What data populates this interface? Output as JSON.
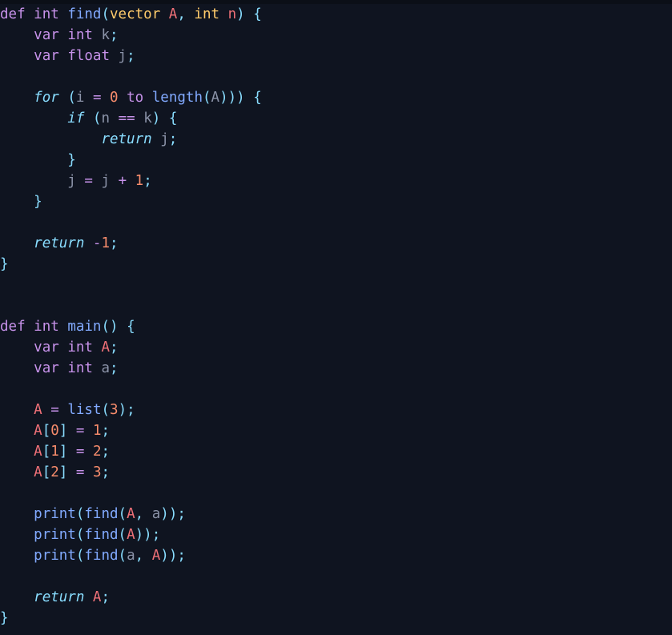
{
  "editor": {
    "name": "code-editor",
    "language": "pseudocode",
    "background_color": "#0f1420",
    "top_edge_color": "#0b0f17",
    "font_size_px": 17.5,
    "line_height_px": 26,
    "indent_spaces": 4,
    "total_lines": 33
  },
  "theme": {
    "name": "dark-material",
    "foreground": "#c6cde0",
    "keyword_declaration": "#c792ea",
    "keyword_control": "#89ddff",
    "function": "#82aaff",
    "type": "#ffcb6b",
    "error_identifier": "#f07178",
    "identifier": "#8b93a8",
    "number": "#f78c6c",
    "operator": "#c792ea",
    "punctuation": "#89ddff"
  },
  "code": {
    "lines": [
      {
        "n": 1,
        "text": "def int find(vector A, int n) {",
        "tokens": [
          {
            "t": "def",
            "c": "tok-def"
          },
          {
            "t": " ",
            "c": "plain"
          },
          {
            "t": "int",
            "c": "tok-def"
          },
          {
            "t": " ",
            "c": "plain"
          },
          {
            "t": "find",
            "c": "tok-fn"
          },
          {
            "t": "(",
            "c": "tok-punct"
          },
          {
            "t": "vector",
            "c": "tok-type"
          },
          {
            "t": " ",
            "c": "plain"
          },
          {
            "t": "A",
            "c": "tok-err"
          },
          {
            "t": ",",
            "c": "tok-punct"
          },
          {
            "t": " ",
            "c": "plain"
          },
          {
            "t": "int",
            "c": "tok-type"
          },
          {
            "t": " ",
            "c": "plain"
          },
          {
            "t": "n",
            "c": "tok-err"
          },
          {
            "t": ")",
            "c": "tok-punct"
          },
          {
            "t": " ",
            "c": "plain"
          },
          {
            "t": "{",
            "c": "tok-punct"
          }
        ]
      },
      {
        "n": 2,
        "text": "    var int k;",
        "tokens": [
          {
            "t": "    ",
            "c": "plain"
          },
          {
            "t": "var",
            "c": "tok-def"
          },
          {
            "t": " ",
            "c": "plain"
          },
          {
            "t": "int",
            "c": "tok-def"
          },
          {
            "t": " ",
            "c": "plain"
          },
          {
            "t": "k",
            "c": "tok-var"
          },
          {
            "t": ";",
            "c": "tok-punct"
          }
        ]
      },
      {
        "n": 3,
        "text": "    var float j;",
        "tokens": [
          {
            "t": "    ",
            "c": "plain"
          },
          {
            "t": "var",
            "c": "tok-def"
          },
          {
            "t": " ",
            "c": "plain"
          },
          {
            "t": "float",
            "c": "tok-def"
          },
          {
            "t": " ",
            "c": "plain"
          },
          {
            "t": "j",
            "c": "tok-var"
          },
          {
            "t": ";",
            "c": "tok-punct"
          }
        ]
      },
      {
        "n": 4,
        "text": "",
        "tokens": []
      },
      {
        "n": 5,
        "text": "    for (i = 0 to length(A))) {",
        "tokens": [
          {
            "t": "    ",
            "c": "plain"
          },
          {
            "t": "for",
            "c": "tok-kw"
          },
          {
            "t": " ",
            "c": "plain"
          },
          {
            "t": "(",
            "c": "tok-punct"
          },
          {
            "t": "i",
            "c": "tok-var"
          },
          {
            "t": " ",
            "c": "plain"
          },
          {
            "t": "=",
            "c": "tok-op"
          },
          {
            "t": " ",
            "c": "plain"
          },
          {
            "t": "0",
            "c": "tok-num"
          },
          {
            "t": " ",
            "c": "plain"
          },
          {
            "t": "to",
            "c": "tok-op-kw"
          },
          {
            "t": " ",
            "c": "plain"
          },
          {
            "t": "length",
            "c": "tok-fn"
          },
          {
            "t": "(",
            "c": "tok-punct"
          },
          {
            "t": "A",
            "c": "tok-var"
          },
          {
            "t": ")))",
            "c": "tok-punct"
          },
          {
            "t": " ",
            "c": "plain"
          },
          {
            "t": "{",
            "c": "tok-punct"
          }
        ]
      },
      {
        "n": 6,
        "text": "        if (n == k) {",
        "tokens": [
          {
            "t": "        ",
            "c": "plain"
          },
          {
            "t": "if",
            "c": "tok-kw"
          },
          {
            "t": " ",
            "c": "plain"
          },
          {
            "t": "(",
            "c": "tok-punct"
          },
          {
            "t": "n",
            "c": "tok-var"
          },
          {
            "t": " ",
            "c": "plain"
          },
          {
            "t": "==",
            "c": "tok-op"
          },
          {
            "t": " ",
            "c": "plain"
          },
          {
            "t": "k",
            "c": "tok-var"
          },
          {
            "t": ")",
            "c": "tok-punct"
          },
          {
            "t": " ",
            "c": "plain"
          },
          {
            "t": "{",
            "c": "tok-punct"
          }
        ]
      },
      {
        "n": 7,
        "text": "            return j;",
        "tokens": [
          {
            "t": "            ",
            "c": "plain"
          },
          {
            "t": "return",
            "c": "tok-kw"
          },
          {
            "t": " ",
            "c": "plain"
          },
          {
            "t": "j",
            "c": "tok-var"
          },
          {
            "t": ";",
            "c": "tok-punct"
          }
        ]
      },
      {
        "n": 8,
        "text": "        }",
        "tokens": [
          {
            "t": "        ",
            "c": "plain"
          },
          {
            "t": "}",
            "c": "tok-punct"
          }
        ]
      },
      {
        "n": 9,
        "text": "        j = j + 1;",
        "tokens": [
          {
            "t": "        ",
            "c": "plain"
          },
          {
            "t": "j",
            "c": "tok-var"
          },
          {
            "t": " ",
            "c": "plain"
          },
          {
            "t": "=",
            "c": "tok-op"
          },
          {
            "t": " ",
            "c": "plain"
          },
          {
            "t": "j",
            "c": "tok-var"
          },
          {
            "t": " ",
            "c": "plain"
          },
          {
            "t": "+",
            "c": "tok-op"
          },
          {
            "t": " ",
            "c": "plain"
          },
          {
            "t": "1",
            "c": "tok-num"
          },
          {
            "t": ";",
            "c": "tok-punct"
          }
        ]
      },
      {
        "n": 10,
        "text": "    }",
        "tokens": [
          {
            "t": "    ",
            "c": "plain"
          },
          {
            "t": "}",
            "c": "tok-punct"
          }
        ]
      },
      {
        "n": 11,
        "text": "",
        "tokens": []
      },
      {
        "n": 12,
        "text": "    return -1;",
        "tokens": [
          {
            "t": "    ",
            "c": "plain"
          },
          {
            "t": "return",
            "c": "tok-kw"
          },
          {
            "t": " ",
            "c": "plain"
          },
          {
            "t": "-",
            "c": "tok-op"
          },
          {
            "t": "1",
            "c": "tok-num"
          },
          {
            "t": ";",
            "c": "tok-punct"
          }
        ]
      },
      {
        "n": 13,
        "text": "}",
        "tokens": [
          {
            "t": "}",
            "c": "tok-punct"
          }
        ]
      },
      {
        "n": 14,
        "text": "",
        "tokens": []
      },
      {
        "n": 15,
        "text": "",
        "tokens": []
      },
      {
        "n": 16,
        "text": "def int main() {",
        "tokens": [
          {
            "t": "def",
            "c": "tok-def"
          },
          {
            "t": " ",
            "c": "plain"
          },
          {
            "t": "int",
            "c": "tok-def"
          },
          {
            "t": " ",
            "c": "plain"
          },
          {
            "t": "main",
            "c": "tok-fn"
          },
          {
            "t": "()",
            "c": "tok-punct"
          },
          {
            "t": " ",
            "c": "plain"
          },
          {
            "t": "{",
            "c": "tok-punct"
          }
        ]
      },
      {
        "n": 17,
        "text": "    var int A;",
        "tokens": [
          {
            "t": "    ",
            "c": "plain"
          },
          {
            "t": "var",
            "c": "tok-def"
          },
          {
            "t": " ",
            "c": "plain"
          },
          {
            "t": "int",
            "c": "tok-def"
          },
          {
            "t": " ",
            "c": "plain"
          },
          {
            "t": "A",
            "c": "tok-err"
          },
          {
            "t": ";",
            "c": "tok-punct"
          }
        ]
      },
      {
        "n": 18,
        "text": "    var int a;",
        "tokens": [
          {
            "t": "    ",
            "c": "plain"
          },
          {
            "t": "var",
            "c": "tok-def"
          },
          {
            "t": " ",
            "c": "plain"
          },
          {
            "t": "int",
            "c": "tok-def"
          },
          {
            "t": " ",
            "c": "plain"
          },
          {
            "t": "a",
            "c": "tok-var"
          },
          {
            "t": ";",
            "c": "tok-punct"
          }
        ]
      },
      {
        "n": 19,
        "text": "",
        "tokens": []
      },
      {
        "n": 20,
        "text": "    A = list(3);",
        "tokens": [
          {
            "t": "    ",
            "c": "plain"
          },
          {
            "t": "A",
            "c": "tok-err"
          },
          {
            "t": " ",
            "c": "plain"
          },
          {
            "t": "=",
            "c": "tok-op"
          },
          {
            "t": " ",
            "c": "plain"
          },
          {
            "t": "list",
            "c": "tok-fn"
          },
          {
            "t": "(",
            "c": "tok-punct"
          },
          {
            "t": "3",
            "c": "tok-num"
          },
          {
            "t": ");",
            "c": "tok-punct"
          }
        ]
      },
      {
        "n": 21,
        "text": "    A[0] = 1;",
        "tokens": [
          {
            "t": "    ",
            "c": "plain"
          },
          {
            "t": "A",
            "c": "tok-err"
          },
          {
            "t": "[",
            "c": "tok-punct"
          },
          {
            "t": "0",
            "c": "tok-num"
          },
          {
            "t": "]",
            "c": "tok-punct"
          },
          {
            "t": " ",
            "c": "plain"
          },
          {
            "t": "=",
            "c": "tok-op"
          },
          {
            "t": " ",
            "c": "plain"
          },
          {
            "t": "1",
            "c": "tok-num"
          },
          {
            "t": ";",
            "c": "tok-punct"
          }
        ]
      },
      {
        "n": 22,
        "text": "    A[1] = 2;",
        "tokens": [
          {
            "t": "    ",
            "c": "plain"
          },
          {
            "t": "A",
            "c": "tok-err"
          },
          {
            "t": "[",
            "c": "tok-punct"
          },
          {
            "t": "1",
            "c": "tok-num"
          },
          {
            "t": "]",
            "c": "tok-punct"
          },
          {
            "t": " ",
            "c": "plain"
          },
          {
            "t": "=",
            "c": "tok-op"
          },
          {
            "t": " ",
            "c": "plain"
          },
          {
            "t": "2",
            "c": "tok-num"
          },
          {
            "t": ";",
            "c": "tok-punct"
          }
        ]
      },
      {
        "n": 23,
        "text": "    A[2] = 3;",
        "tokens": [
          {
            "t": "    ",
            "c": "plain"
          },
          {
            "t": "A",
            "c": "tok-err"
          },
          {
            "t": "[",
            "c": "tok-punct"
          },
          {
            "t": "2",
            "c": "tok-num"
          },
          {
            "t": "]",
            "c": "tok-punct"
          },
          {
            "t": " ",
            "c": "plain"
          },
          {
            "t": "=",
            "c": "tok-op"
          },
          {
            "t": " ",
            "c": "plain"
          },
          {
            "t": "3",
            "c": "tok-num"
          },
          {
            "t": ";",
            "c": "tok-punct"
          }
        ]
      },
      {
        "n": 24,
        "text": "",
        "tokens": []
      },
      {
        "n": 25,
        "text": "    print(find(A, a));",
        "tokens": [
          {
            "t": "    ",
            "c": "plain"
          },
          {
            "t": "print",
            "c": "tok-fn"
          },
          {
            "t": "(",
            "c": "tok-punct"
          },
          {
            "t": "find",
            "c": "tok-fn"
          },
          {
            "t": "(",
            "c": "tok-punct"
          },
          {
            "t": "A",
            "c": "tok-err"
          },
          {
            "t": ",",
            "c": "tok-punct"
          },
          {
            "t": " ",
            "c": "plain"
          },
          {
            "t": "a",
            "c": "tok-var"
          },
          {
            "t": "));",
            "c": "tok-punct"
          }
        ]
      },
      {
        "n": 26,
        "text": "    print(find(A));",
        "tokens": [
          {
            "t": "    ",
            "c": "plain"
          },
          {
            "t": "print",
            "c": "tok-fn"
          },
          {
            "t": "(",
            "c": "tok-punct"
          },
          {
            "t": "find",
            "c": "tok-fn"
          },
          {
            "t": "(",
            "c": "tok-punct"
          },
          {
            "t": "A",
            "c": "tok-err"
          },
          {
            "t": "));",
            "c": "tok-punct"
          }
        ]
      },
      {
        "n": 27,
        "text": "    print(find(a, A));",
        "tokens": [
          {
            "t": "    ",
            "c": "plain"
          },
          {
            "t": "print",
            "c": "tok-fn"
          },
          {
            "t": "(",
            "c": "tok-punct"
          },
          {
            "t": "find",
            "c": "tok-fn"
          },
          {
            "t": "(",
            "c": "tok-punct"
          },
          {
            "t": "a",
            "c": "tok-var"
          },
          {
            "t": ",",
            "c": "tok-punct"
          },
          {
            "t": " ",
            "c": "plain"
          },
          {
            "t": "A",
            "c": "tok-err"
          },
          {
            "t": "));",
            "c": "tok-punct"
          }
        ]
      },
      {
        "n": 28,
        "text": "",
        "tokens": []
      },
      {
        "n": 29,
        "text": "    return A;",
        "tokens": [
          {
            "t": "    ",
            "c": "plain"
          },
          {
            "t": "return",
            "c": "tok-kw"
          },
          {
            "t": " ",
            "c": "plain"
          },
          {
            "t": "A",
            "c": "tok-err"
          },
          {
            "t": ";",
            "c": "tok-punct"
          }
        ]
      },
      {
        "n": 30,
        "text": "}",
        "tokens": [
          {
            "t": "}",
            "c": "tok-punct"
          }
        ]
      }
    ]
  }
}
